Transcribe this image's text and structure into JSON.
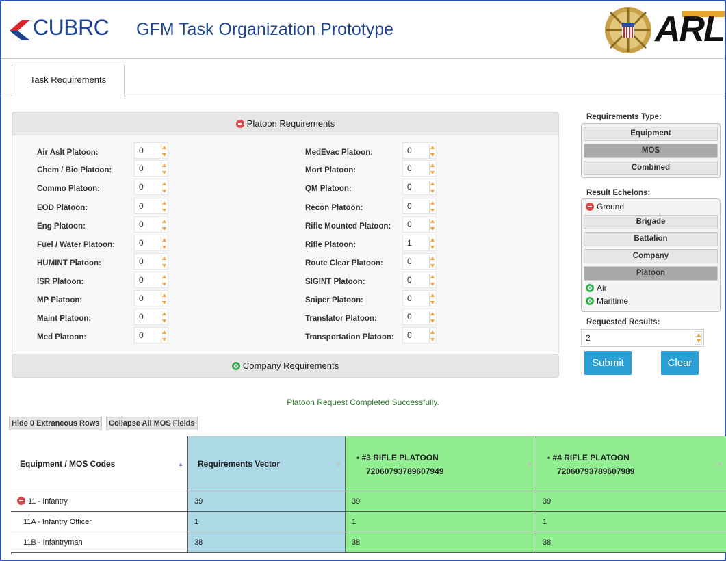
{
  "header": {
    "brand": "CUBRC",
    "app_title": "GFM Task Organization Prototype",
    "partner_logo_text": "ARL",
    "brand_color": "#1f4591"
  },
  "tabs": [
    {
      "label": "Task Requirements",
      "active": true
    }
  ],
  "platoon_panel": {
    "title": "Platoon Requirements",
    "expanded": true,
    "left_fields": [
      {
        "label": "Air Aslt Platoon:",
        "value": "0"
      },
      {
        "label": "Chem / Bio Platoon:",
        "value": "0"
      },
      {
        "label": "Commo Platoon:",
        "value": "0"
      },
      {
        "label": "EOD Platoon:",
        "value": "0"
      },
      {
        "label": "Eng Platoon:",
        "value": "0"
      },
      {
        "label": "Fuel / Water Platoon:",
        "value": "0"
      },
      {
        "label": "HUMINT Platoon:",
        "value": "0"
      },
      {
        "label": "ISR Platoon:",
        "value": "0"
      },
      {
        "label": "MP Platoon:",
        "value": "0"
      },
      {
        "label": "Maint Platoon:",
        "value": "0"
      },
      {
        "label": "Med Platoon:",
        "value": "0"
      }
    ],
    "right_fields": [
      {
        "label": "MedEvac Platoon:",
        "value": "0"
      },
      {
        "label": "Mort Platoon:",
        "value": "0"
      },
      {
        "label": "QM Platoon:",
        "value": "0"
      },
      {
        "label": "Recon Platoon:",
        "value": "0"
      },
      {
        "label": "Rifle Mounted Platoon:",
        "value": "0"
      },
      {
        "label": "Rifle Platoon:",
        "value": "1"
      },
      {
        "label": "Route Clear Platoon:",
        "value": "0"
      },
      {
        "label": "SIGINT Platoon:",
        "value": "0"
      },
      {
        "label": "Sniper Platoon:",
        "value": "0"
      },
      {
        "label": "Translator Platoon:",
        "value": "0"
      },
      {
        "label": "Transportation Platoon:",
        "value": "0"
      }
    ]
  },
  "company_panel": {
    "title": "Company Requirements",
    "expanded": false
  },
  "sidebar": {
    "requirements_type_label": "Requirements Type:",
    "requirements_types": [
      {
        "label": "Equipment",
        "active": false
      },
      {
        "label": "MOS",
        "active": true
      },
      {
        "label": "Combined",
        "active": false
      }
    ],
    "result_echelons_label": "Result Echelons:",
    "ground_label": "Ground",
    "echelons": [
      {
        "label": "Brigade",
        "active": false
      },
      {
        "label": "Battalion",
        "active": false
      },
      {
        "label": "Company",
        "active": false
      },
      {
        "label": "Platoon",
        "active": true
      }
    ],
    "air_label": "Air",
    "maritime_label": "Maritime",
    "requested_results_label": "Requested Results:",
    "requested_results_value": "2",
    "submit_label": "Submit",
    "clear_label": "Clear"
  },
  "status_message": "Platoon Request Completed Successfully.",
  "actions": {
    "hide_rows_label": "Hide 0 Extraneous Rows",
    "collapse_label": "Collapse All MOS Fields"
  },
  "table": {
    "columns": [
      {
        "label": "Equipment / MOS Codes",
        "color": "#ffffff"
      },
      {
        "label": "Requirements Vector",
        "color": "#add8e6"
      },
      {
        "label": "#3 RIFLE PLATOON",
        "sub": "72060793789607949",
        "color": "#90ee90"
      },
      {
        "label": "#4 RIFLE PLATOON",
        "sub": "72060793789607989",
        "color": "#90ee90"
      }
    ],
    "rows": [
      {
        "code": "11 - Infantry",
        "group": true,
        "values": [
          "39",
          "39",
          "39"
        ]
      },
      {
        "code": "11A - Infantry Officer",
        "group": false,
        "values": [
          "1",
          "1",
          "1"
        ]
      },
      {
        "code": "11B - Infantryman",
        "group": false,
        "values": [
          "38",
          "38",
          "38"
        ]
      }
    ]
  }
}
